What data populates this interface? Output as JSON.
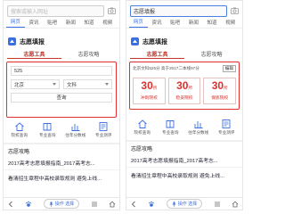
{
  "colors": {
    "accent": "#3a6fe0",
    "highlight": "#e03030",
    "stat_red": "#d9322f"
  },
  "left": {
    "search_placeholder": "搜索或输入网址",
    "tabs": [
      "网页",
      "资讯",
      "贴吧",
      "新闻",
      "知道",
      "视频"
    ],
    "card_title": "志愿填报",
    "sub_tabs": [
      "志愿工具",
      "志愿攻略"
    ],
    "score_value": "525",
    "province_select": "北京",
    "subject_select": "文科",
    "query_button": "查询",
    "icons": [
      {
        "name": "home-icon",
        "label": "院校查询"
      },
      {
        "name": "book-icon",
        "label": "专业查询"
      },
      {
        "name": "chart-icon",
        "label": "往年分数线"
      },
      {
        "name": "quiz-icon",
        "label": "专业测评"
      }
    ],
    "section_title": "志愿攻略",
    "articles": [
      "2017高考志愿填报指南_2017高考志...",
      "看清招生章程中高校录取规则  避免上线..."
    ],
    "bottom_button": "操作 选择"
  },
  "right": {
    "search_value": "志愿填报",
    "tabs": [
      "网页",
      "资讯",
      "贴吧",
      "新闻",
      "知道",
      "视频"
    ],
    "card_title": "志愿填报",
    "sub_tabs": [
      "志愿工具",
      "志愿攻略"
    ],
    "summary": "北京文科525分  高于2017二本线97分",
    "edit_button": "编辑",
    "stats": [
      {
        "value": "30",
        "unit": "所",
        "label": "冲刺院校"
      },
      {
        "value": "30",
        "unit": "所",
        "label": "稳妥院校"
      },
      {
        "value": "30",
        "unit": "所",
        "label": "保底院校"
      }
    ],
    "icons": [
      {
        "name": "home-icon",
        "label": "院校查询"
      },
      {
        "name": "book-icon",
        "label": "专业查询"
      },
      {
        "name": "chart-icon",
        "label": "往年分数线"
      },
      {
        "name": "quiz-icon",
        "label": "专业测评"
      }
    ],
    "section_title": "志愿攻略",
    "articles": [
      "2017高考志愿填报指南_2017高考志...",
      "看清招生章程中高校录取规则  避免上线..."
    ],
    "bottom_button": "操作 选择"
  }
}
